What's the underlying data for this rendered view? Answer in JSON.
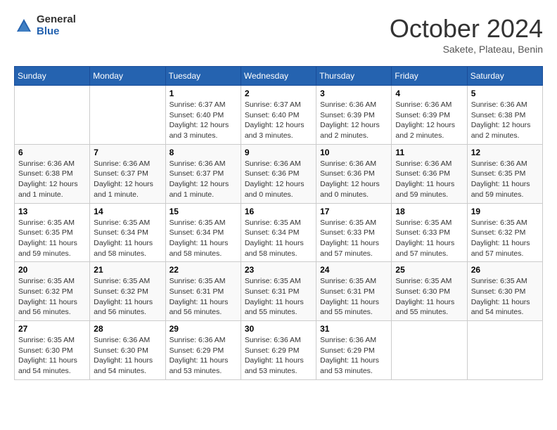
{
  "logo": {
    "general": "General",
    "blue": "Blue"
  },
  "title": "October 2024",
  "subtitle": "Sakete, Plateau, Benin",
  "headers": [
    "Sunday",
    "Monday",
    "Tuesday",
    "Wednesday",
    "Thursday",
    "Friday",
    "Saturday"
  ],
  "weeks": [
    [
      {
        "day": "",
        "info": ""
      },
      {
        "day": "",
        "info": ""
      },
      {
        "day": "1",
        "info": "Sunrise: 6:37 AM\nSunset: 6:40 PM\nDaylight: 12 hours and 3 minutes."
      },
      {
        "day": "2",
        "info": "Sunrise: 6:37 AM\nSunset: 6:40 PM\nDaylight: 12 hours and 3 minutes."
      },
      {
        "day": "3",
        "info": "Sunrise: 6:36 AM\nSunset: 6:39 PM\nDaylight: 12 hours and 2 minutes."
      },
      {
        "day": "4",
        "info": "Sunrise: 6:36 AM\nSunset: 6:39 PM\nDaylight: 12 hours and 2 minutes."
      },
      {
        "day": "5",
        "info": "Sunrise: 6:36 AM\nSunset: 6:38 PM\nDaylight: 12 hours and 2 minutes."
      }
    ],
    [
      {
        "day": "6",
        "info": "Sunrise: 6:36 AM\nSunset: 6:38 PM\nDaylight: 12 hours and 1 minute."
      },
      {
        "day": "7",
        "info": "Sunrise: 6:36 AM\nSunset: 6:37 PM\nDaylight: 12 hours and 1 minute."
      },
      {
        "day": "8",
        "info": "Sunrise: 6:36 AM\nSunset: 6:37 PM\nDaylight: 12 hours and 1 minute."
      },
      {
        "day": "9",
        "info": "Sunrise: 6:36 AM\nSunset: 6:36 PM\nDaylight: 12 hours and 0 minutes."
      },
      {
        "day": "10",
        "info": "Sunrise: 6:36 AM\nSunset: 6:36 PM\nDaylight: 12 hours and 0 minutes."
      },
      {
        "day": "11",
        "info": "Sunrise: 6:36 AM\nSunset: 6:36 PM\nDaylight: 11 hours and 59 minutes."
      },
      {
        "day": "12",
        "info": "Sunrise: 6:36 AM\nSunset: 6:35 PM\nDaylight: 11 hours and 59 minutes."
      }
    ],
    [
      {
        "day": "13",
        "info": "Sunrise: 6:35 AM\nSunset: 6:35 PM\nDaylight: 11 hours and 59 minutes."
      },
      {
        "day": "14",
        "info": "Sunrise: 6:35 AM\nSunset: 6:34 PM\nDaylight: 11 hours and 58 minutes."
      },
      {
        "day": "15",
        "info": "Sunrise: 6:35 AM\nSunset: 6:34 PM\nDaylight: 11 hours and 58 minutes."
      },
      {
        "day": "16",
        "info": "Sunrise: 6:35 AM\nSunset: 6:34 PM\nDaylight: 11 hours and 58 minutes."
      },
      {
        "day": "17",
        "info": "Sunrise: 6:35 AM\nSunset: 6:33 PM\nDaylight: 11 hours and 57 minutes."
      },
      {
        "day": "18",
        "info": "Sunrise: 6:35 AM\nSunset: 6:33 PM\nDaylight: 11 hours and 57 minutes."
      },
      {
        "day": "19",
        "info": "Sunrise: 6:35 AM\nSunset: 6:32 PM\nDaylight: 11 hours and 57 minutes."
      }
    ],
    [
      {
        "day": "20",
        "info": "Sunrise: 6:35 AM\nSunset: 6:32 PM\nDaylight: 11 hours and 56 minutes."
      },
      {
        "day": "21",
        "info": "Sunrise: 6:35 AM\nSunset: 6:32 PM\nDaylight: 11 hours and 56 minutes."
      },
      {
        "day": "22",
        "info": "Sunrise: 6:35 AM\nSunset: 6:31 PM\nDaylight: 11 hours and 56 minutes."
      },
      {
        "day": "23",
        "info": "Sunrise: 6:35 AM\nSunset: 6:31 PM\nDaylight: 11 hours and 55 minutes."
      },
      {
        "day": "24",
        "info": "Sunrise: 6:35 AM\nSunset: 6:31 PM\nDaylight: 11 hours and 55 minutes."
      },
      {
        "day": "25",
        "info": "Sunrise: 6:35 AM\nSunset: 6:30 PM\nDaylight: 11 hours and 55 minutes."
      },
      {
        "day": "26",
        "info": "Sunrise: 6:35 AM\nSunset: 6:30 PM\nDaylight: 11 hours and 54 minutes."
      }
    ],
    [
      {
        "day": "27",
        "info": "Sunrise: 6:35 AM\nSunset: 6:30 PM\nDaylight: 11 hours and 54 minutes."
      },
      {
        "day": "28",
        "info": "Sunrise: 6:36 AM\nSunset: 6:30 PM\nDaylight: 11 hours and 54 minutes."
      },
      {
        "day": "29",
        "info": "Sunrise: 6:36 AM\nSunset: 6:29 PM\nDaylight: 11 hours and 53 minutes."
      },
      {
        "day": "30",
        "info": "Sunrise: 6:36 AM\nSunset: 6:29 PM\nDaylight: 11 hours and 53 minutes."
      },
      {
        "day": "31",
        "info": "Sunrise: 6:36 AM\nSunset: 6:29 PM\nDaylight: 11 hours and 53 minutes."
      },
      {
        "day": "",
        "info": ""
      },
      {
        "day": "",
        "info": ""
      }
    ]
  ]
}
